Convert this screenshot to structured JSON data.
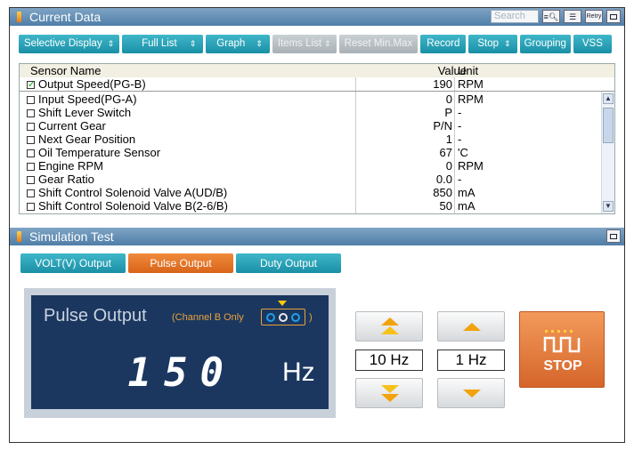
{
  "current_data": {
    "title": "Current Data",
    "search_placeholder": "Search",
    "retry_label": "Retry",
    "toolbar": [
      {
        "label": "Selective Display",
        "has_spinner": true,
        "enabled": true
      },
      {
        "label": "Full List",
        "has_spinner": true,
        "enabled": true
      },
      {
        "label": "Graph",
        "has_spinner": true,
        "enabled": true
      },
      {
        "label": "Items List",
        "has_spinner": true,
        "enabled": false
      },
      {
        "label": "Reset Min.Max",
        "has_spinner": false,
        "enabled": false
      },
      {
        "label": "Record",
        "has_spinner": false,
        "enabled": true
      },
      {
        "label": "Stop",
        "has_spinner": true,
        "enabled": true
      },
      {
        "label": "Grouping",
        "has_spinner": false,
        "enabled": true
      },
      {
        "label": "VSS",
        "has_spinner": false,
        "enabled": true
      }
    ],
    "columns": {
      "name": "Sensor Name",
      "value": "Value",
      "unit": "Unit"
    },
    "pinned_row": {
      "name": "Output Speed(PG-B)",
      "value": "190",
      "unit": "RPM",
      "checked": true
    },
    "rows": [
      {
        "name": "Input Speed(PG-A)",
        "value": "0",
        "unit": "RPM"
      },
      {
        "name": "Shift Lever Switch",
        "value": "P",
        "unit": "-"
      },
      {
        "name": "Current Gear",
        "value": "P/N",
        "unit": "-"
      },
      {
        "name": "Next Gear Position",
        "value": "1",
        "unit": "-"
      },
      {
        "name": "Oil Temperature Sensor",
        "value": "67",
        "unit": "'C"
      },
      {
        "name": "Engine RPM",
        "value": "0",
        "unit": "RPM"
      },
      {
        "name": "Gear Ratio",
        "value": "0.0",
        "unit": "-"
      },
      {
        "name": "Shift Control Solenoid Valve A(UD/B)",
        "value": "850",
        "unit": "mA"
      },
      {
        "name": "Shift Control Solenoid Valve B(2-6/B)",
        "value": "50",
        "unit": "mA"
      }
    ]
  },
  "simulation": {
    "title": "Simulation Test",
    "tabs": [
      {
        "label": "VOLT(V) Output",
        "active": false
      },
      {
        "label": "Pulse Output",
        "active": true
      },
      {
        "label": "Duty Output",
        "active": false
      }
    ],
    "display": {
      "title": "Pulse Output",
      "channel_note": "(Channel B Only",
      "channel_close": ")",
      "value": "150",
      "unit": "Hz"
    },
    "step_coarse": "10 Hz",
    "step_fine": "1 Hz",
    "stop_label": "STOP"
  }
}
